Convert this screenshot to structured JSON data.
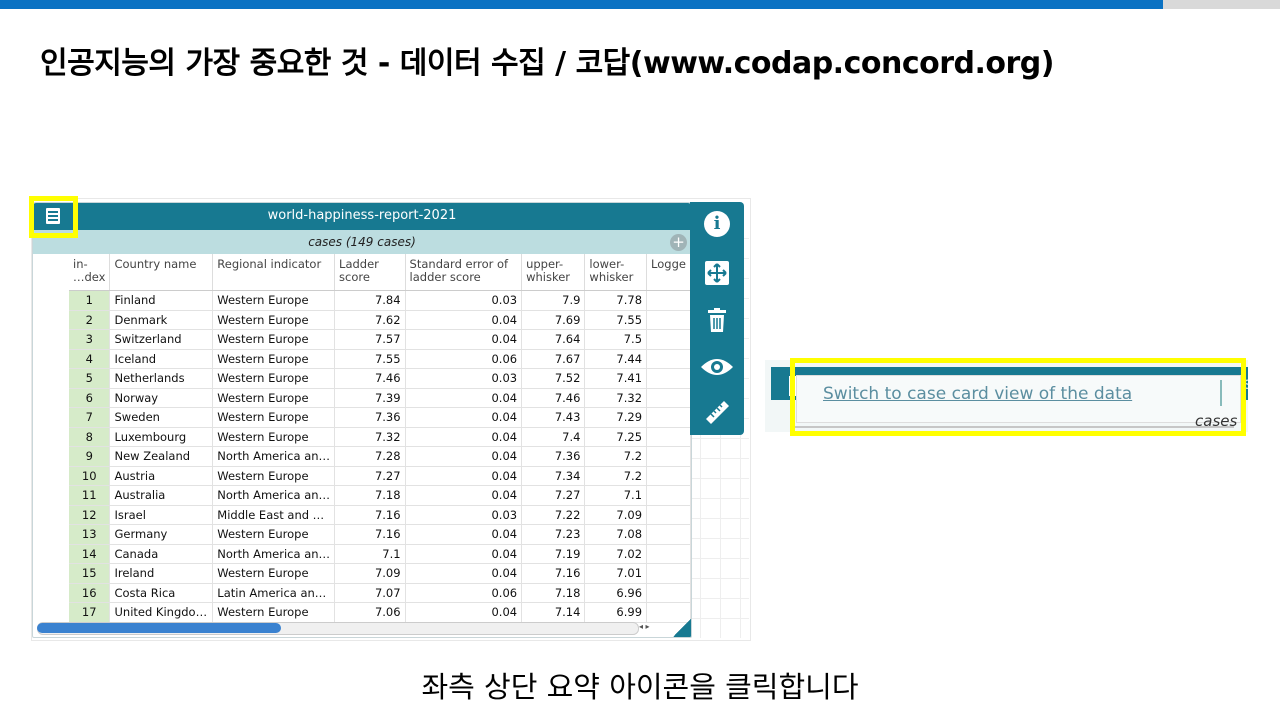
{
  "slide": {
    "title": "인공지능의 가장 중요한 것 - 데이터 수집 / 코답(www.codap.concord.org)",
    "caption": "좌측 상단 요약 아이콘을 클릭합니다"
  },
  "table": {
    "window_title": "world-happiness-report-2021",
    "cases_label": "cases (149 cases)",
    "columns": [
      "in-\n…dex",
      "Country name",
      "Regional indicator",
      "Ladder\nscore",
      "Standard error of\nladder score",
      "upper-\nwhisker",
      "lower-\nwhisker",
      "Logge"
    ],
    "rows": [
      [
        "1",
        "Finland",
        "Western Europe",
        "7.84",
        "0.03",
        "7.9",
        "7.78"
      ],
      [
        "2",
        "Denmark",
        "Western Europe",
        "7.62",
        "0.04",
        "7.69",
        "7.55"
      ],
      [
        "3",
        "Switzerland",
        "Western Europe",
        "7.57",
        "0.04",
        "7.64",
        "7.5"
      ],
      [
        "4",
        "Iceland",
        "Western Europe",
        "7.55",
        "0.06",
        "7.67",
        "7.44"
      ],
      [
        "5",
        "Netherlands",
        "Western Europe",
        "7.46",
        "0.03",
        "7.52",
        "7.41"
      ],
      [
        "6",
        "Norway",
        "Western Europe",
        "7.39",
        "0.04",
        "7.46",
        "7.32"
      ],
      [
        "7",
        "Sweden",
        "Western Europe",
        "7.36",
        "0.04",
        "7.43",
        "7.29"
      ],
      [
        "8",
        "Luxembourg",
        "Western Europe",
        "7.32",
        "0.04",
        "7.4",
        "7.25"
      ],
      [
        "9",
        "New Zealand",
        "North America an…",
        "7.28",
        "0.04",
        "7.36",
        "7.2"
      ],
      [
        "10",
        "Austria",
        "Western Europe",
        "7.27",
        "0.04",
        "7.34",
        "7.2"
      ],
      [
        "11",
        "Australia",
        "North America an…",
        "7.18",
        "0.04",
        "7.27",
        "7.1"
      ],
      [
        "12",
        "Israel",
        "Middle East and …",
        "7.16",
        "0.03",
        "7.22",
        "7.09"
      ],
      [
        "13",
        "Germany",
        "Western Europe",
        "7.16",
        "0.04",
        "7.23",
        "7.08"
      ],
      [
        "14",
        "Canada",
        "North America an…",
        "7.1",
        "0.04",
        "7.19",
        "7.02"
      ],
      [
        "15",
        "Ireland",
        "Western Europe",
        "7.09",
        "0.04",
        "7.16",
        "7.01"
      ],
      [
        "16",
        "Costa Rica",
        "Latin America an…",
        "7.07",
        "0.06",
        "7.18",
        "6.96"
      ],
      [
        "17",
        "United Kingdo…",
        "Western Europe",
        "7.06",
        "0.04",
        "7.14",
        "6.99"
      ]
    ]
  },
  "toolbar": {
    "icons": [
      "info-icon",
      "scale-icon",
      "trash-icon",
      "eye-icon",
      "ruler-icon"
    ],
    "info_glyph": "i"
  },
  "inset": {
    "tooltip": "Switch to case card view of the data",
    "title_fragment": "world-happiness",
    "cases_fragment": "cases"
  },
  "colors": {
    "accent": "#177991",
    "highlight": "#ffff00",
    "top_bar": "#0b72c3",
    "index_cell": "#d6ebc9"
  }
}
